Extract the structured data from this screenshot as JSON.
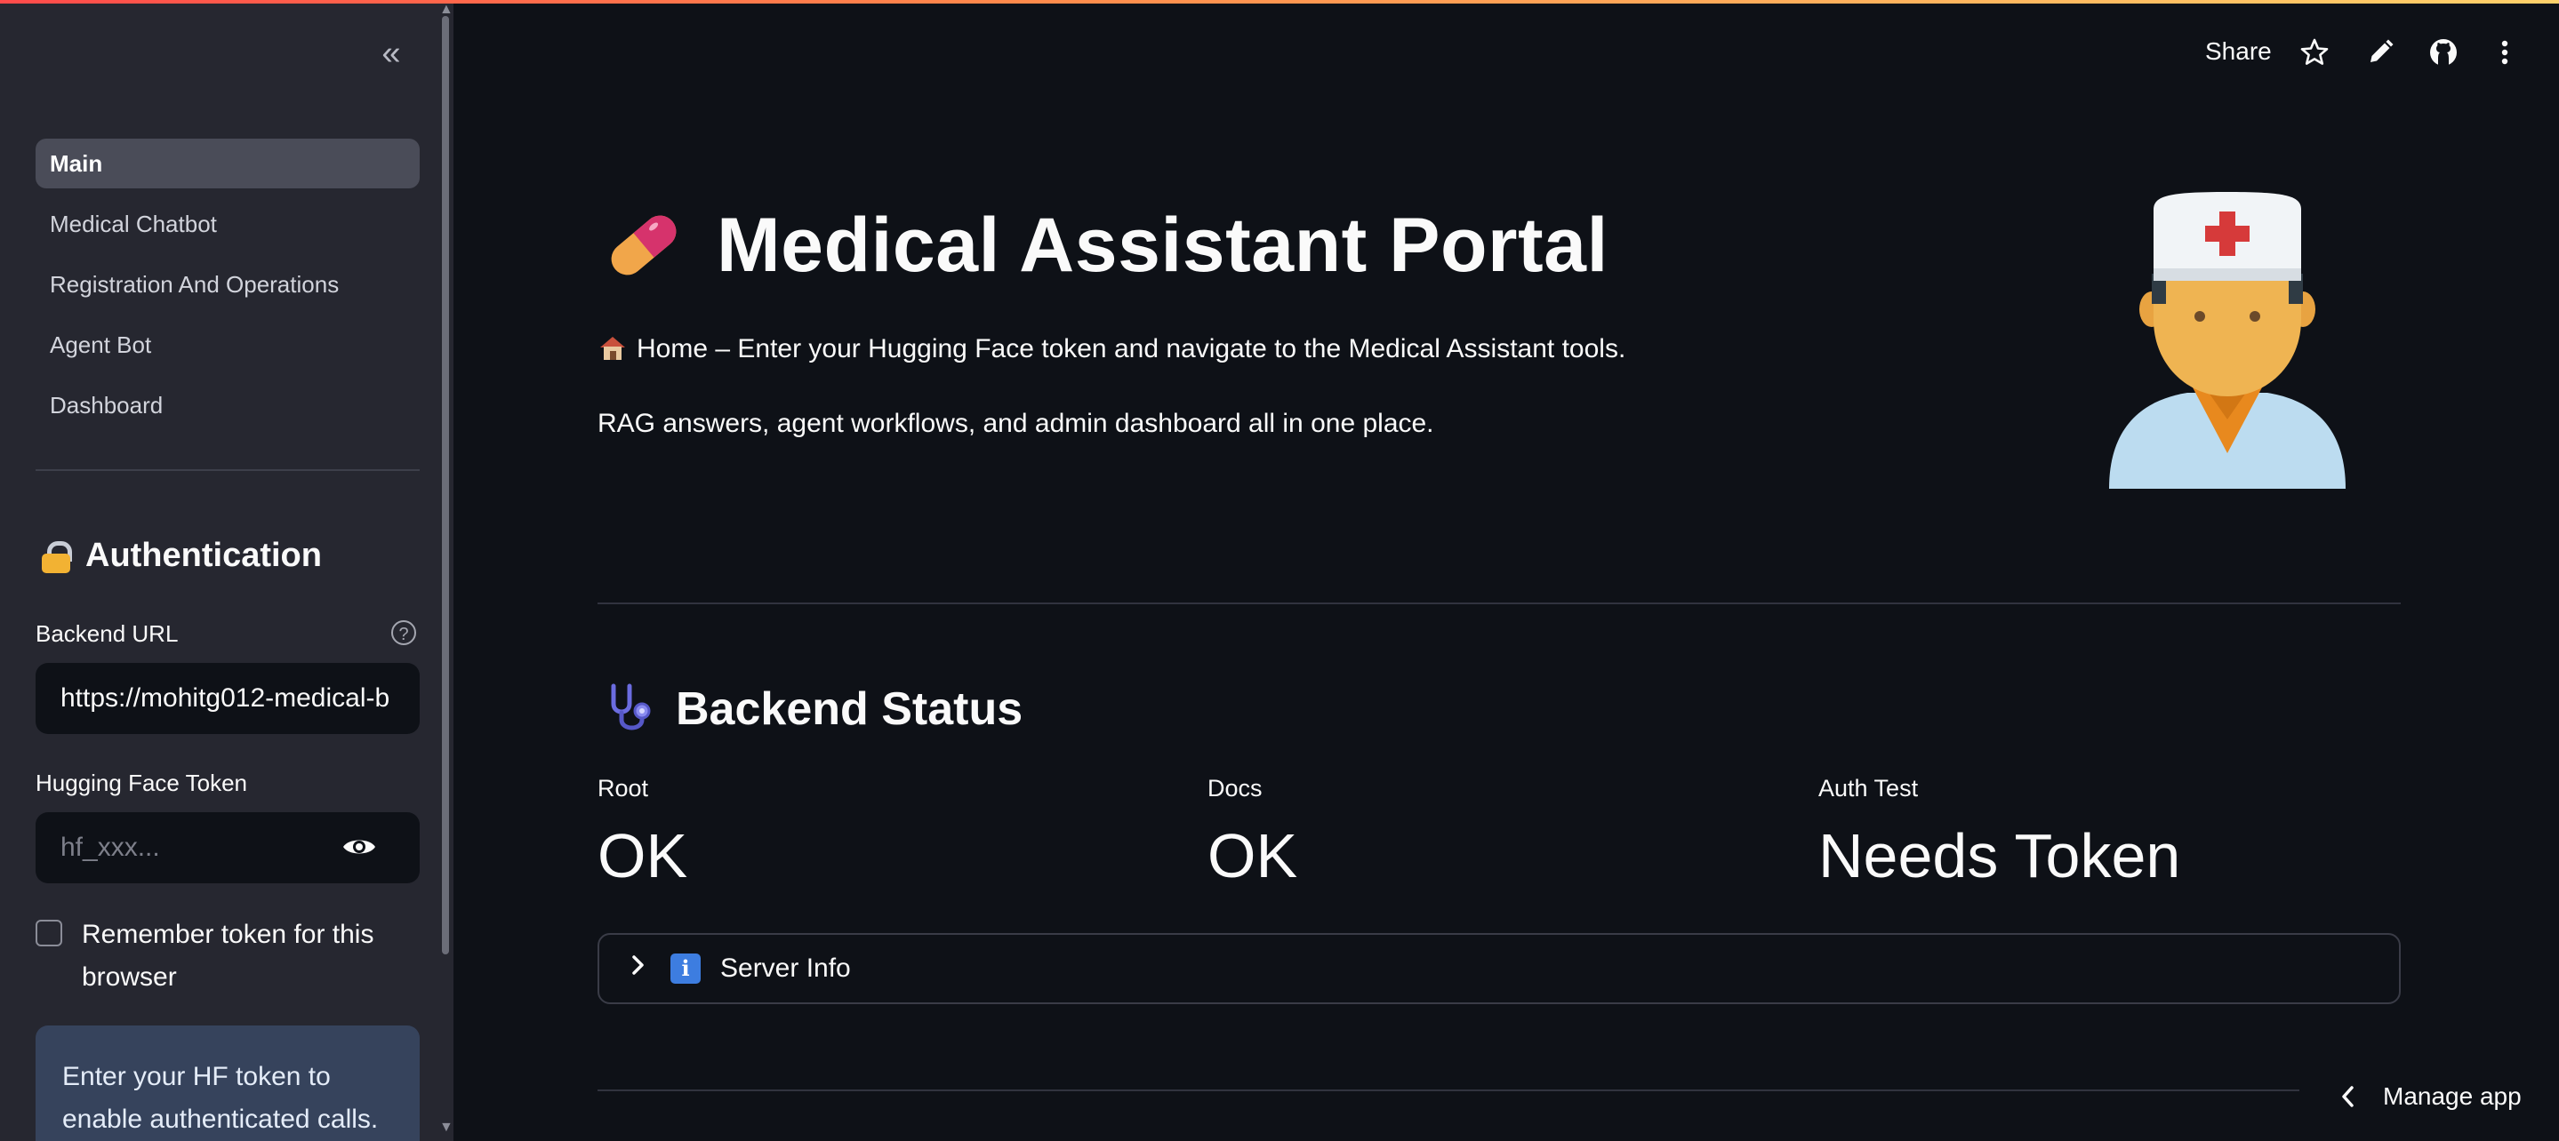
{
  "sidebar": {
    "nav_items": [
      {
        "label": "Main",
        "active": true
      },
      {
        "label": "Medical Chatbot",
        "active": false
      },
      {
        "label": "Registration And Operations",
        "active": false
      },
      {
        "label": "Agent Bot",
        "active": false
      },
      {
        "label": "Dashboard",
        "active": false
      }
    ],
    "auth": {
      "title": "Authentication",
      "backend_url_label": "Backend URL",
      "backend_url_value": "https://mohitg012-medical-b",
      "hf_token_label": "Hugging Face Token",
      "hf_token_placeholder": "hf_xxx...",
      "remember_label": "Remember token for this browser",
      "remember_checked": false,
      "info_text": "Enter your HF token to enable authenticated calls."
    }
  },
  "toolbar": {
    "share_label": "Share",
    "icons": [
      "star-icon",
      "pencil-icon",
      "github-icon",
      "more-vertical-icon"
    ]
  },
  "main": {
    "title": "Medical Assistant Portal",
    "subtitle": "Home – Enter your Hugging Face token and navigate to the Medical Assistant tools.",
    "description": "RAG answers, agent workflows, and admin dashboard all in one place.",
    "backend_status": {
      "title": "Backend Status",
      "metrics": [
        {
          "label": "Root",
          "value": "OK"
        },
        {
          "label": "Docs",
          "value": "OK"
        },
        {
          "label": "Auth Test",
          "value": "Needs Token"
        }
      ]
    },
    "server_info_label": "Server Info"
  },
  "footer": {
    "manage_app_label": "Manage app"
  },
  "colors": {
    "background": "#0e1117",
    "sidebar": "#262730",
    "accent_gradient_start": "#ff4b4b",
    "accent_gradient_end": "#ffd16a",
    "info_box": "#36435c"
  }
}
